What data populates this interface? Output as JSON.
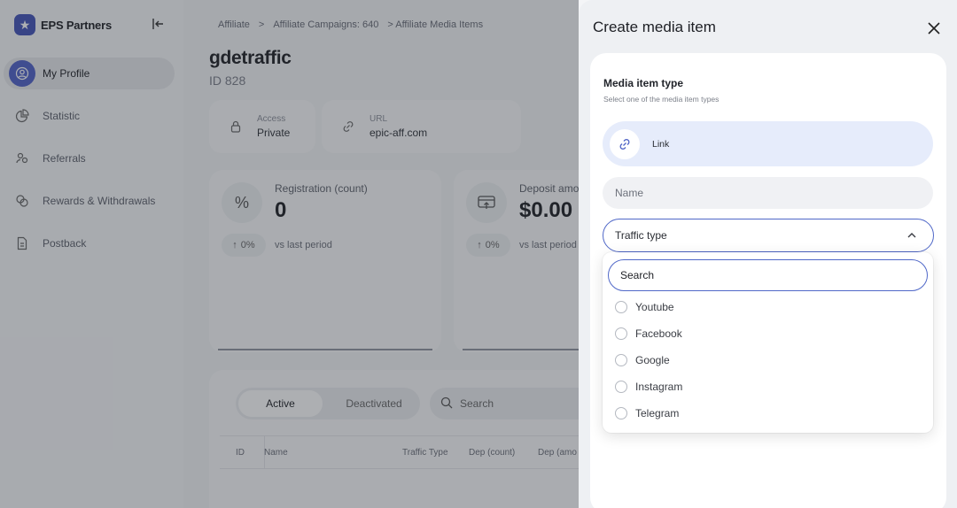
{
  "sidebar": {
    "brand": "EPS Partners",
    "items": [
      {
        "label": "My Profile",
        "icon": "user-circle-icon",
        "active": true
      },
      {
        "label": "Statistic",
        "icon": "pie-chart-icon"
      },
      {
        "label": "Referrals",
        "icon": "people-icon"
      },
      {
        "label": "Rewards & Withdrawals",
        "icon": "coins-icon"
      },
      {
        "label": "Postback",
        "icon": "document-icon"
      }
    ]
  },
  "breadcrumb": [
    "Affiliate",
    ">",
    "Affiliate Campaigns: 640",
    "> Affiliate Media Items"
  ],
  "page": {
    "title": "gdetraffic",
    "id_text": "ID 828",
    "access_label": "Access",
    "access_value": "Private",
    "url_label": "URL",
    "url_value": "epic-aff.com"
  },
  "stats": [
    {
      "icon": "%",
      "label": "Registration (count)",
      "value": "0",
      "delta": "0%",
      "compare": "vs last period"
    },
    {
      "icon": "deposit-icon",
      "label": "Deposit amo",
      "value": "$0.00",
      "delta": "0%",
      "compare": "vs last period"
    }
  ],
  "table": {
    "tab_active": "Active",
    "tab_inactive": "Deactivated",
    "search_placeholder": "Search",
    "columns": [
      "ID",
      "Name",
      "Traffic Type",
      "Dep (count)",
      "Dep (amo"
    ]
  },
  "drawer": {
    "title": "Create media item",
    "section_title": "Media item type",
    "section_hint": "Select one of the media item types",
    "type_option": "Link",
    "name_placeholder": "Name",
    "traffic_label": "Traffic type",
    "dropdown_search_placeholder": "Search",
    "traffic_options": [
      "Youtube",
      "Facebook",
      "Google",
      "Instagram",
      "Telegram"
    ]
  },
  "colors": {
    "accent": "#5068c8",
    "active_nav": "#5061c9",
    "tile": "#e6ecfb"
  }
}
